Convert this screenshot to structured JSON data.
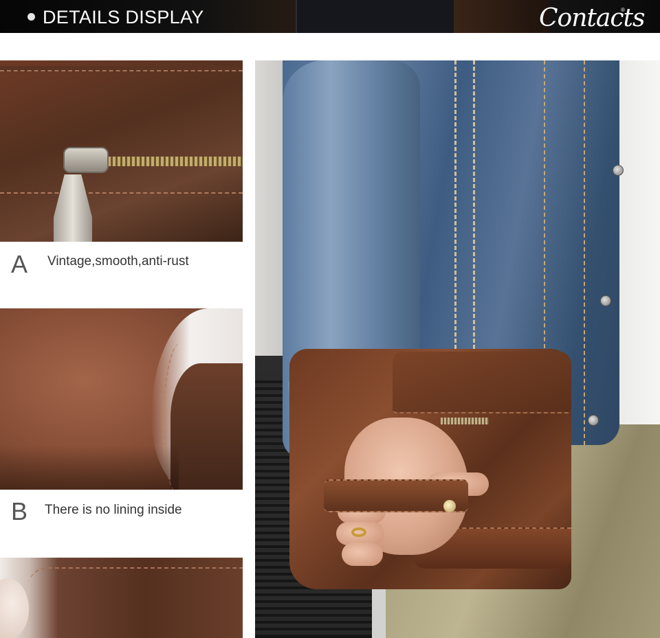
{
  "header": {
    "title": "DETAILS DISPLAY",
    "brand_logo": "Contacts",
    "brand_registered": "®",
    "bullet_icon": "bullet-dot-icon"
  },
  "details": [
    {
      "letter": "A",
      "text": "Vintage,smooth,anti-rust"
    },
    {
      "letter": "B",
      "text": "There is no lining inside"
    }
  ],
  "colors": {
    "header_bg": "#0a0a0a",
    "header_text": "#ffffff",
    "caption_letter": "#555555",
    "caption_text": "#333333",
    "leather_brown": "#6e3a22",
    "denim_blue": "#4a6a90"
  }
}
